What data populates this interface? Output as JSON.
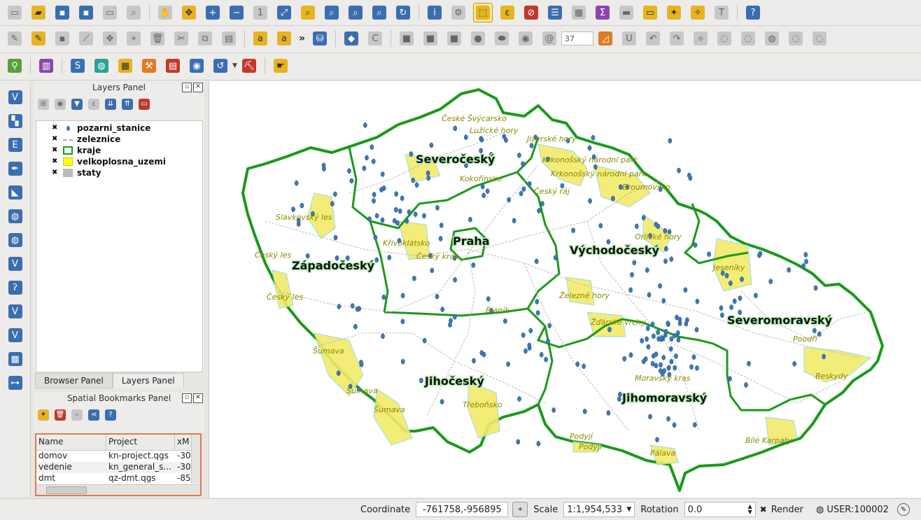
{
  "panels": {
    "layers_title": "Layers Panel",
    "bookmarks_title": "Spatial Bookmarks Panel"
  },
  "layers": [
    {
      "name": "pozarni_stanice",
      "symbol": "point"
    },
    {
      "name": "zeleznice",
      "symbol": "line"
    },
    {
      "name": "kraje",
      "symbol": "polygon-green"
    },
    {
      "name": "velkoplosna_uzemi",
      "symbol": "polygon-yellow"
    },
    {
      "name": "staty",
      "symbol": "polygon-gray"
    }
  ],
  "tabs": [
    "Browser Panel",
    "Layers Panel"
  ],
  "bookmarks": {
    "columns": [
      "Name",
      "Project",
      "xM"
    ],
    "rows": [
      {
        "name": "domov",
        "project": "kn-project.qgs",
        "x": "-30"
      },
      {
        "name": "vedenie",
        "project": "kn_general_s...",
        "x": "-30"
      },
      {
        "name": "dmt",
        "project": "qz-dmt.qgs",
        "x": "-85"
      }
    ]
  },
  "toolbar": {
    "snap_value": "37"
  },
  "map": {
    "regions": [
      "Severočeský",
      "Praha",
      "Západočeský",
      "Východočeský",
      "Severomoravský",
      "Jihočeský",
      "Jihomoravský"
    ],
    "areas": [
      "České Švýcarsko",
      "Lužické hory",
      "Jizerské hory",
      "Krkonošský národní park",
      "Krkonošský národní park",
      "Kokořínsko",
      "Český ráj",
      "Broumovsko",
      "Slavkovský les",
      "Křivoklátsko",
      "Český kras",
      "Orlické hory",
      "Český les",
      "Jeseníky",
      "Český les",
      "Železné hory",
      "Blaník",
      "Žďárské vrchy",
      "Poodří",
      "Šumava",
      "Moravský kras",
      "Beskydy",
      "Šumava",
      "Šumava",
      "Třeboňsko",
      "Podyjí",
      "Podyjí",
      "Pálava",
      "Bílé Karpaty"
    ]
  },
  "status": {
    "coordinate_label": "Coordinate",
    "coordinate": "-761758,-956895",
    "scale_label": "Scale",
    "scale": "1:1,954,533",
    "rotation_label": "Rotation",
    "rotation": "0.0",
    "render_label": "Render",
    "crs": "USER:100002"
  },
  "colors": {
    "region_border": "#1a9a1a",
    "protected_area": "#f2ea6a",
    "station": "#3d78b8"
  }
}
